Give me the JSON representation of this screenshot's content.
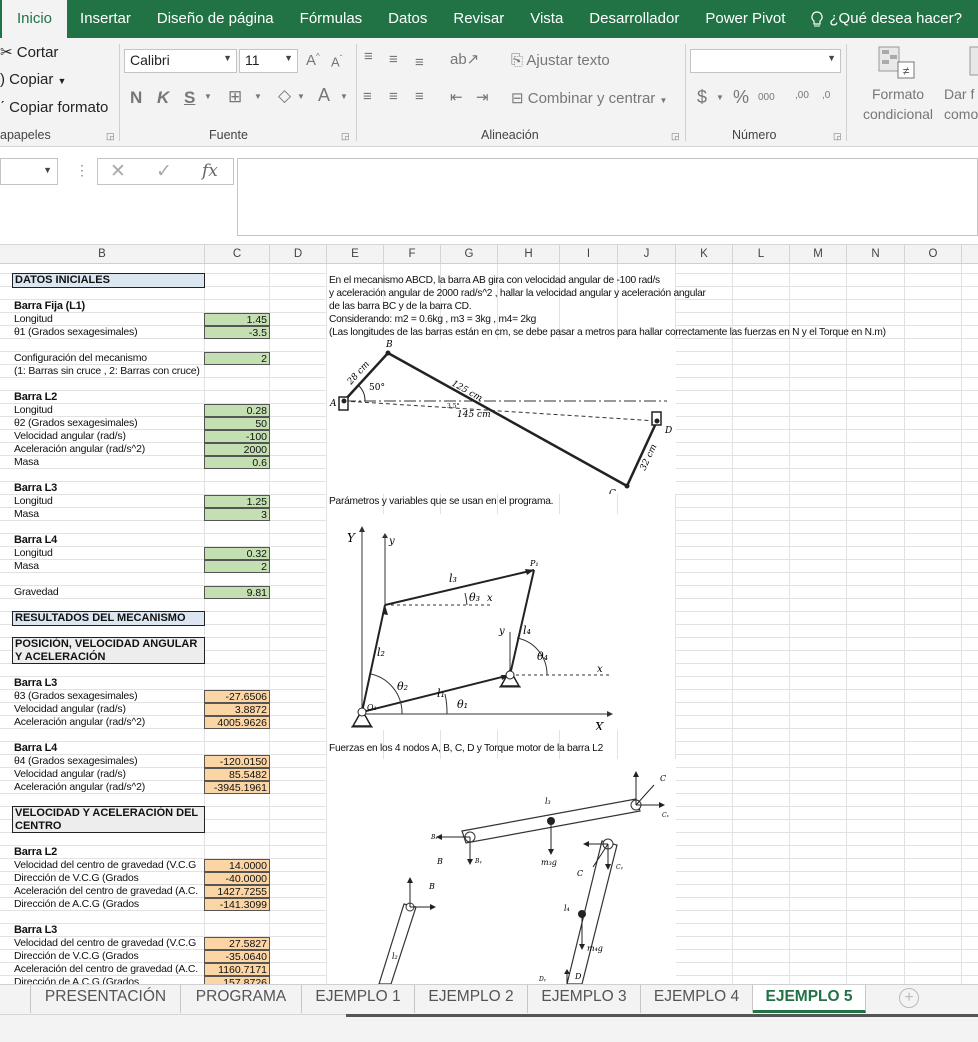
{
  "tabs": [
    "Inicio",
    "Insertar",
    "Diseño de página",
    "Fórmulas",
    "Datos",
    "Revisar",
    "Vista",
    "Desarrollador",
    "Power Pivot"
  ],
  "tell_me": "¿Qué desea hacer?",
  "clipboard": {
    "cut": "Cortar",
    "copy": "Copiar",
    "format_painter": "Copiar formato",
    "label": "apapeles"
  },
  "font": {
    "name": "Calibri",
    "size": "11",
    "label": "Fuente",
    "bold": "N",
    "italic": "K",
    "underline": "S"
  },
  "alignment": {
    "wrap": "Ajustar texto",
    "merge": "Combinar y centrar",
    "label": "Alineación"
  },
  "number": {
    "label": "Número",
    "currency": "$",
    "percent": "%",
    "thousands": "000",
    "dec_inc": ",00",
    "dec_dec": ",0"
  },
  "styles": {
    "conditional": "Formato condicional",
    "table_fmt": "Dar f como"
  },
  "columns": [
    "B",
    "C",
    "D",
    "E",
    "F",
    "G",
    "H",
    "I",
    "J",
    "K",
    "L",
    "M",
    "N",
    "O"
  ],
  "sheet": {
    "datos_iniciales": "DATOS INICIALES",
    "barra_fija": "Barra Fija (L1)",
    "longitud": "Longitud",
    "theta1": "θ1 (Grados sexagesimales)",
    "config": "Configuración del mecanismo",
    "config_note": "(1: Barras sin cruce , 2: Barras con cruce)",
    "barra_l2": "Barra L2",
    "theta2": "θ2 (Grados sexagesimales)",
    "vel_ang": "Velocidad angular (rad/s)",
    "acel_ang": "Aceleración angular (rad/s^2)",
    "masa": "Masa",
    "barra_l3": "Barra L3",
    "barra_l4": "Barra L4",
    "gravedad": "Gravedad",
    "resultados": "RESULTADOS DEL MECANISMO",
    "posicion": "POSICIÓN, VELOCIDAD ANGULAR Y ACELERACIÓN",
    "theta3": "θ3 (Grados sexagesimales)",
    "theta4": "θ4 (Grados sexagesimales)",
    "vel_centro": "VELOCIDAD Y ACELERACIÓN DEL CENTRO",
    "vcg": "Velocidad del centro de gravedad (V.C.G",
    "dir_vcg": "Dirección de V.C.G (Grados",
    "acg": "Aceleración del centro de gravedad (A.C.",
    "dir_acg": "Dirección de A.C.G (Grados",
    "v": {
      "l1_len": "1.45",
      "theta1": "-3.5",
      "config": "2",
      "l2_len": "0.28",
      "theta2": "50",
      "l2_w": "-100",
      "l2_a": "2000",
      "l2_m": "0.6",
      "l3_len": "1.25",
      "l3_m": "3",
      "l4_len": "0.32",
      "l4_m": "2",
      "g": "9.81",
      "r3_theta": "-27.6506",
      "r3_w": "3.8872",
      "r3_a": "4005.9626",
      "r4_theta": "-120.0150",
      "r4_w": "85.5482",
      "r4_a": "-3945.1961",
      "c2_v": "14.0000",
      "c2_dv": "-40.0000",
      "c2_a": "1427.7255",
      "c2_da": "-141.3099",
      "c3_v": "27.5827",
      "c3_dv": "-35.0640",
      "c3_a": "1160.7171",
      "c3_da": "157.8726"
    },
    "problem": [
      "En el mecanismo ABCD, la barra AB gira con velocidad angular de -100 rad/s",
      "y aceleración angular de 2000 rad/s^2 , hallar la velocidad angular y aceleración angular",
      "de las barra BC y de la barra CD.",
      "Considerando: m2 = 0.6kg , m3 = 3kg , m4= 2kg",
      "(Las longitudes de las barras están en cm, se debe pasar a metros para hallar correctamente las fuerzas en N y el Torque en N.m)"
    ],
    "param_text": "Parámetros y variables que se usan en el programa.",
    "forces_text": "Fuerzas en los 4 nodos A, B, C, D y Torque motor de la barra L2"
  },
  "fig1": {
    "B": "B",
    "A": "A",
    "C": "C",
    "D": "D",
    "ab": "28 cm",
    "bc": "125 cm",
    "ad": "145 cm",
    "cd": "32 cm",
    "ang": "50°",
    "ang2": "3.5°"
  },
  "fig2": {
    "X": "X",
    "Y": "Y",
    "x": "x",
    "y": "y",
    "x2": "x",
    "y2": "y",
    "l1": "l₁",
    "l2": "l₂",
    "l3": "l₃",
    "l4": "l₄",
    "t1": "θ₁",
    "t2": "θ₂",
    "t3": "θ₃",
    "t4": "θ₄",
    "O1": "O₁",
    "P1": "P₁"
  },
  "fig3": {
    "l2": "l₂",
    "l3": "l₃",
    "l4": "l₄",
    "B": "B",
    "C": "C",
    "D": "D",
    "Bx": "Bₓ",
    "By": "Bᵧ",
    "Cx": "Cₓ",
    "Cy": "Cᵧ",
    "Dy": "Dᵧ",
    "m3g": "m₃g",
    "m4g": "m₄g"
  },
  "sheet_tabs": [
    "PRESENTACIÓN",
    "PROGRAMA",
    "EJEMPLO 1",
    "EJEMPLO 2",
    "EJEMPLO 3",
    "EJEMPLO 4",
    "EJEMPLO 5"
  ],
  "active_sheet": "EJEMPLO 5",
  "accent": "#217346"
}
